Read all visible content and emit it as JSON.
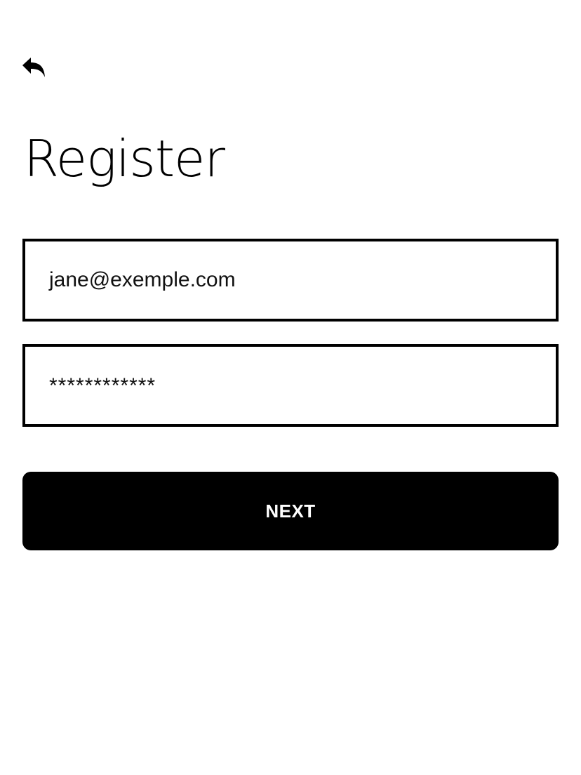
{
  "header": {
    "back_icon": "reply-arrow-icon"
  },
  "page": {
    "title": "Register"
  },
  "form": {
    "email": {
      "value": "jane@exemple.com"
    },
    "password": {
      "value": "************"
    },
    "next_label": "NEXT"
  },
  "colors": {
    "background": "#ffffff",
    "foreground": "#000000",
    "button_text": "#ffffff"
  }
}
